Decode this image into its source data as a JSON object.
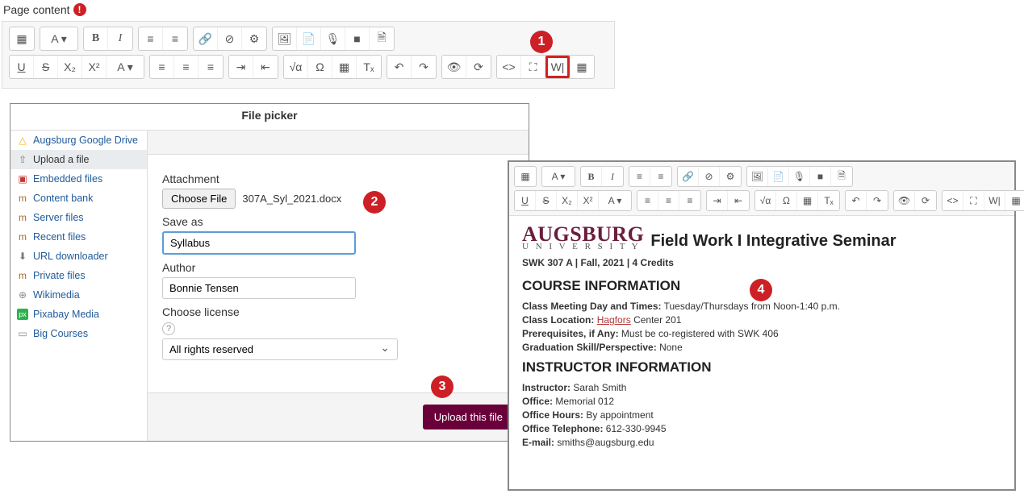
{
  "page_label": "Page content",
  "required_mark": "!",
  "toolbar_main": {
    "row1": {
      "toggle": "▦",
      "font_menu": "A ▾",
      "bold": "B",
      "italic": "I",
      "ul": "≡",
      "ol": "≡",
      "link": "🔗",
      "unlink": "⊘",
      "autolink": "⚙",
      "image": "🖼",
      "file": "📄",
      "audio": "🎙",
      "video": "■",
      "copy": "🗎"
    },
    "row2": {
      "underline": "U",
      "strike": "S",
      "sub": "X₂",
      "sup": "X²",
      "font2": "A ▾",
      "al": "≡",
      "ac": "≡",
      "ar": "≡",
      "indent_in": "⇥",
      "indent_out": "⇤",
      "eq": "√α",
      "omega": "Ω",
      "table": "▦",
      "clear": "Tₓ",
      "undo": "↶",
      "redo": "↷",
      "eye": "👁",
      "a11y": "⟳",
      "html": "<>",
      "full": "⛶",
      "word": "W|",
      "grid": "▦"
    }
  },
  "badges": {
    "b1": "1",
    "b2": "2",
    "b3": "3",
    "b4": "4"
  },
  "file_picker": {
    "title": "File picker",
    "repos": [
      {
        "label": "Augsburg Google Drive",
        "icon": "△",
        "cls": "ico-gd"
      },
      {
        "label": "Upload a file",
        "icon": "⇧",
        "cls": "ico-up",
        "active": true
      },
      {
        "label": "Embedded files",
        "icon": "▣",
        "cls": "ico-ef"
      },
      {
        "label": "Content bank",
        "icon": "m",
        "cls": "ico-m"
      },
      {
        "label": "Server files",
        "icon": "m",
        "cls": "ico-m"
      },
      {
        "label": "Recent files",
        "icon": "m",
        "cls": "ico-m"
      },
      {
        "label": "URL downloader",
        "icon": "⬇",
        "cls": "ico-up"
      },
      {
        "label": "Private files",
        "icon": "m",
        "cls": "ico-m"
      },
      {
        "label": "Wikimedia",
        "icon": "⊕",
        "cls": "ico-wk"
      },
      {
        "label": "Pixabay Media",
        "icon": "px",
        "cls": "ico-px"
      },
      {
        "label": "Big Courses",
        "icon": "▭",
        "cls": "ico-bc"
      }
    ],
    "form": {
      "attachment_label": "Attachment",
      "choose_button": "Choose File",
      "chosen_file": "307A_Syl_2021.docx",
      "saveas_label": "Save as",
      "saveas_value": "Syllabus",
      "author_label": "Author",
      "author_value": "Bonnie Tensen",
      "license_label": "Choose license",
      "license_value": "All rights reserved",
      "upload_button": "Upload this file"
    }
  },
  "preview": {
    "logo_top": "AUGSBURG",
    "logo_sub": "U N I V E R S I T Y",
    "course_title": "Field Work I Integrative Seminar",
    "meta": "SWK 307 A | Fall, 2021 | 4 Credits",
    "section_course": "COURSE INFORMATION",
    "lines_course": {
      "meet_k": "Class Meeting Day and Times:",
      "meet_v": " Tuesday/Thursdays from Noon-1:40 p.m.",
      "loc_k": "Class Location:",
      "loc_link": "Hagfors",
      "loc_v": " Center 201",
      "pre_k": "Prerequisites, if Any:",
      "pre_v": " Must be co-registered with SWK 406",
      "grad_k": "Graduation Skill/Perspective:",
      "grad_v": " None"
    },
    "section_instr": "INSTRUCTOR INFORMATION",
    "lines_instr": {
      "instr_k": "Instructor:",
      "instr_v": " Sarah Smith",
      "off_k": "Office:",
      "off_v": " Memorial 012",
      "hrs_k": "Office Hours:",
      "hrs_v": " By appointment",
      "tel_k": "Office Telephone:",
      "tel_v": " 612-330-9945",
      "em_k": "E-mail:",
      "em_v": " smiths@augsburg.edu"
    }
  }
}
